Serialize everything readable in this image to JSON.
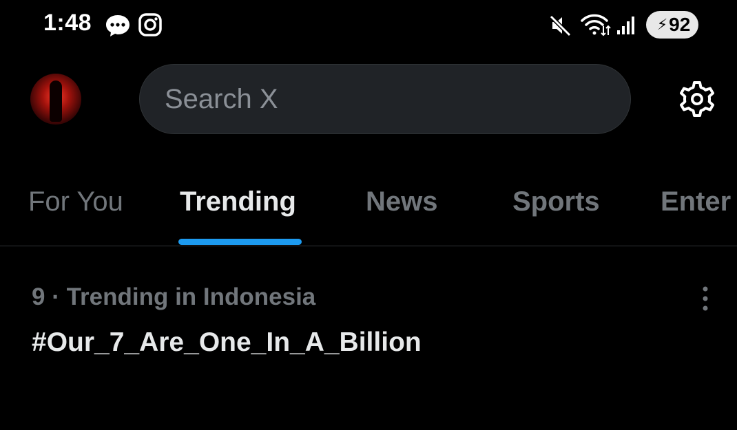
{
  "status_bar": {
    "time": "1:48",
    "battery_level": "92",
    "icons": [
      "message-icon",
      "instagram-icon",
      "mute-icon",
      "wifi-icon",
      "signal-icon",
      "battery-icon"
    ]
  },
  "header": {
    "search": {
      "placeholder": "Search X",
      "value": ""
    }
  },
  "tabs": [
    {
      "label": "For You",
      "active": false
    },
    {
      "label": "Trending",
      "active": true
    },
    {
      "label": "News",
      "active": false
    },
    {
      "label": "Sports",
      "active": false
    },
    {
      "label": "Enter",
      "active": false
    }
  ],
  "trends": [
    {
      "meta": "9 · Trending in Indonesia",
      "title": "#Our_7_Are_One_In_A_Billion"
    }
  ],
  "colors": {
    "background": "#000000",
    "accent": "#1d9bf0",
    "secondary_text": "#71767b",
    "primary_text": "#e7e9ea"
  }
}
